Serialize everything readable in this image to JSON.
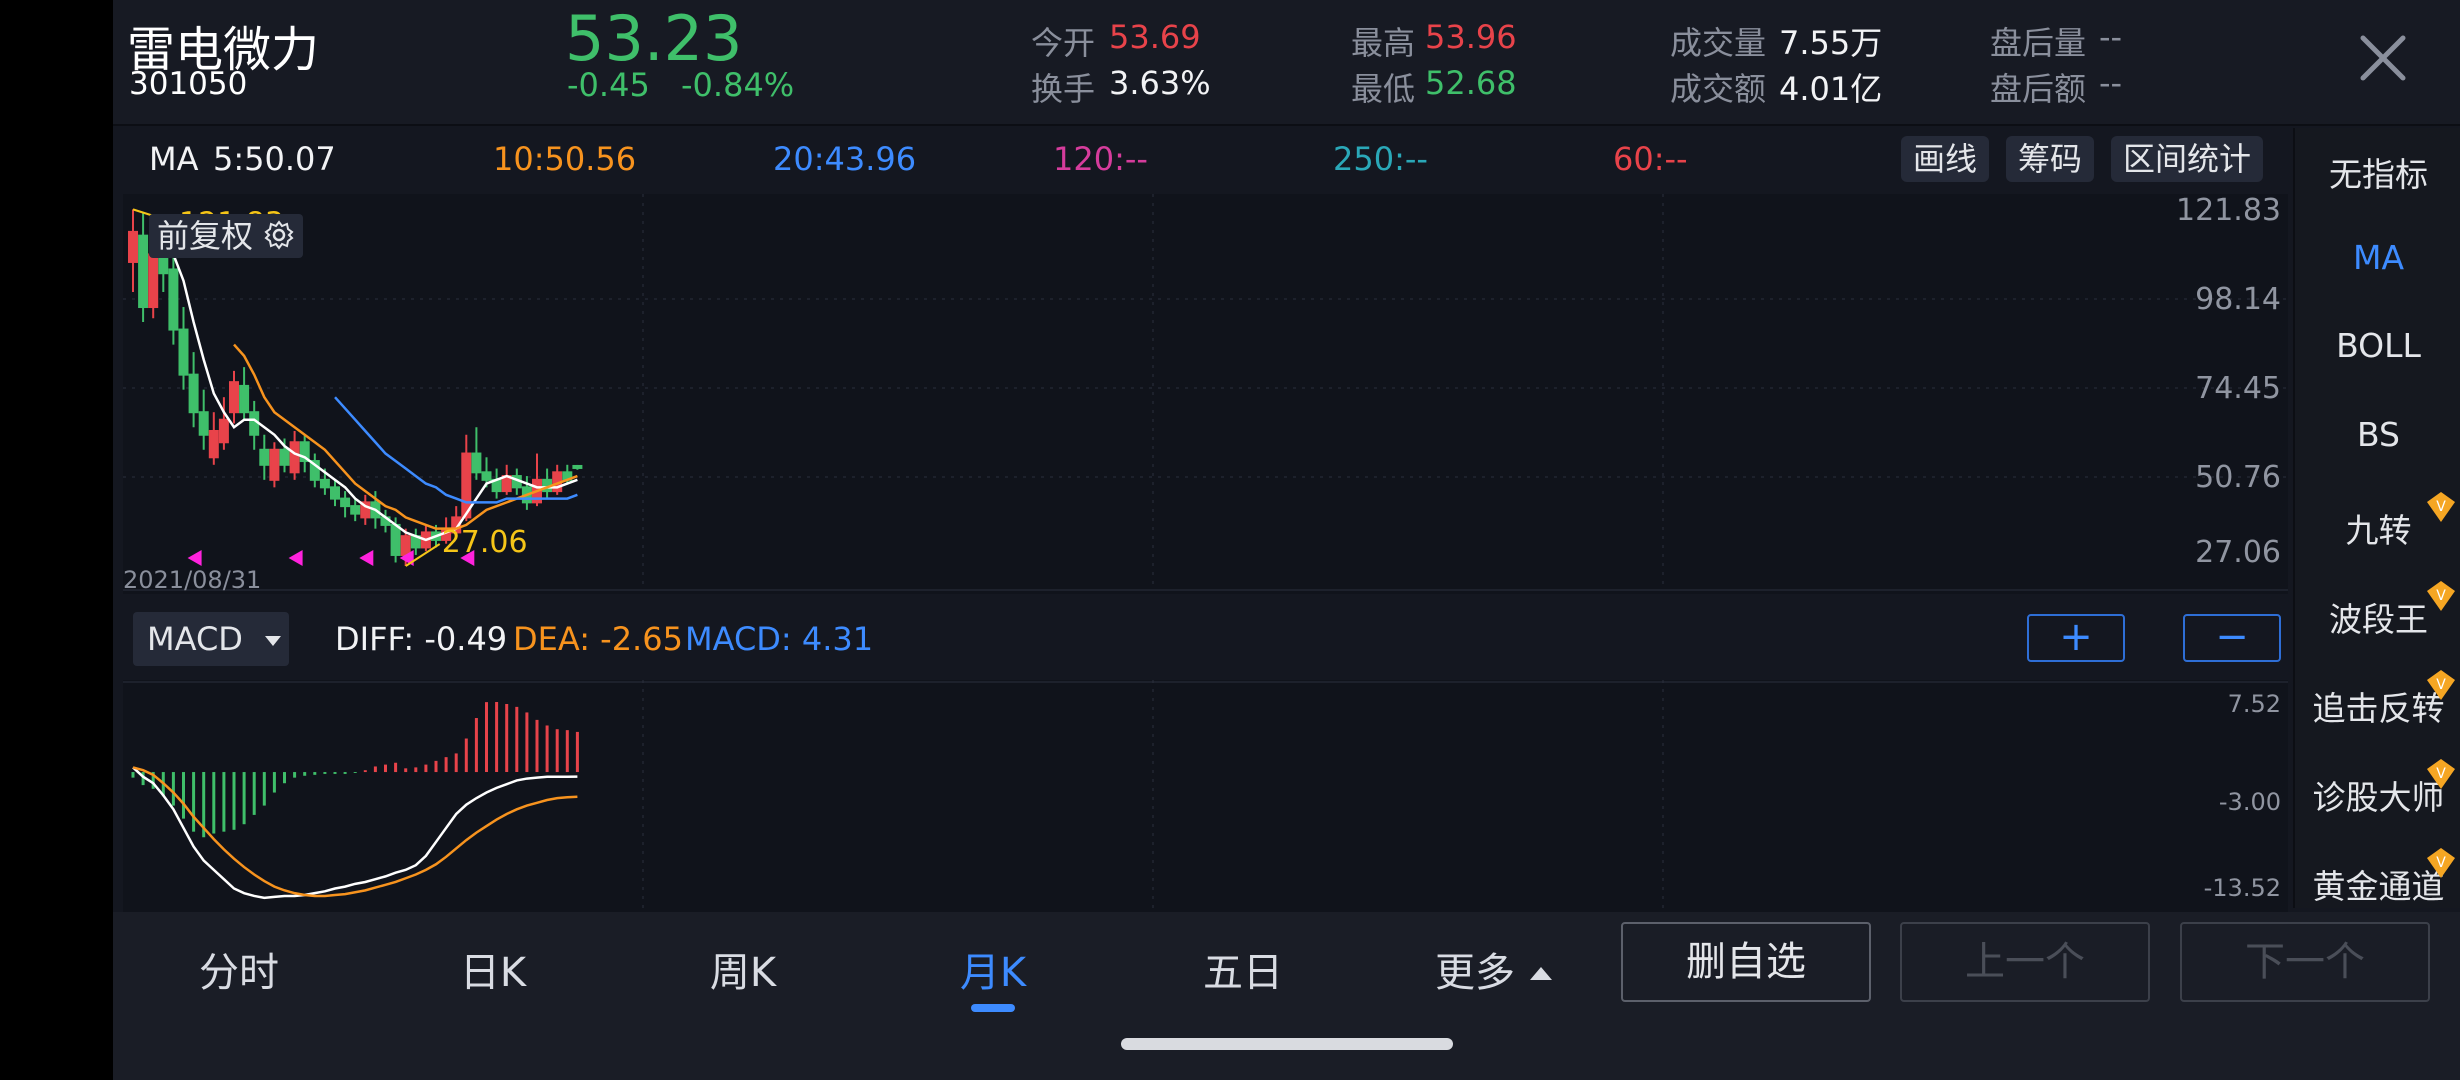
{
  "header": {
    "stock_name": "雷电微力",
    "stock_code": "301050",
    "price": "53.23",
    "change": "-0.45",
    "change_pct": "-0.84%",
    "stats": {
      "open_label": "今开",
      "open_value": "53.69",
      "high_label": "最高",
      "high_value": "53.96",
      "volume_label": "成交量",
      "volume_value": "7.55万",
      "after_vol_label": "盘后量",
      "after_vol_value": "--",
      "turnover_label": "换手",
      "turnover_value": "3.63%",
      "low_label": "最低",
      "low_value": "52.68",
      "amount_label": "成交额",
      "amount_value": "4.01亿",
      "after_amt_label": "盘后额",
      "after_amt_value": "--"
    }
  },
  "ma_bar": {
    "ma_label": "MA",
    "ma5": "5:50.07",
    "ma10": "10:50.56",
    "ma20": "20:43.96",
    "ma120": "120:--",
    "ma250": "250:--",
    "ma60": "60:--",
    "tool_draw": "画线",
    "tool_chips": "筹码",
    "tool_range": "区间统计"
  },
  "kline": {
    "adjust_label": "前复权",
    "date_label": "2021/08/31",
    "max_label": "121.83",
    "min_label": "27.06",
    "y_ticks": [
      "121.83",
      "98.14",
      "74.45",
      "50.76",
      "27.06"
    ]
  },
  "macd": {
    "selector": "MACD",
    "diff": "DIFF: -0.49",
    "dea": "DEA: -2.65",
    "macd": "MACD: 4.31",
    "plus": "+",
    "minus": "−",
    "y_ticks": [
      "7.52",
      "-3.00",
      "-13.52"
    ]
  },
  "sidebar": {
    "items": [
      "无指标",
      "MA",
      "BOLL",
      "BS",
      "九转",
      "波段王",
      "追击反转",
      "诊股大师",
      "黄金通道"
    ]
  },
  "bottom": {
    "tabs": [
      "分时",
      "日K",
      "周K",
      "月K",
      "五日",
      "更多"
    ],
    "btn_remove": "删自选",
    "btn_prev": "上一个",
    "btn_next": "下一个"
  },
  "colors": {
    "up": "#e8434a",
    "down": "#3fbf6a",
    "accent": "#3d8bff",
    "ma5": "#ffffff",
    "ma10": "#f7931e",
    "ma20": "#3d8bff"
  },
  "chart_data": {
    "type": "candlestick",
    "period": "monthly",
    "first_date": "2021/08/31",
    "ylim": [
      27.06,
      121.83
    ],
    "candles": [
      {
        "o": 108,
        "c": 116,
        "h": 122,
        "l": 100
      },
      {
        "o": 115,
        "c": 96,
        "h": 121,
        "l": 92
      },
      {
        "o": 96,
        "c": 110,
        "h": 114,
        "l": 93
      },
      {
        "o": 112,
        "c": 105,
        "h": 117,
        "l": 100
      },
      {
        "o": 106,
        "c": 90,
        "h": 110,
        "l": 86
      },
      {
        "o": 90,
        "c": 78,
        "h": 96,
        "l": 74
      },
      {
        "o": 78,
        "c": 68,
        "h": 84,
        "l": 64
      },
      {
        "o": 68,
        "c": 62,
        "h": 74,
        "l": 58
      },
      {
        "o": 56,
        "c": 63,
        "h": 68,
        "l": 54
      },
      {
        "o": 60,
        "c": 66,
        "h": 72,
        "l": 58
      },
      {
        "o": 68,
        "c": 76,
        "h": 79,
        "l": 65
      },
      {
        "o": 75,
        "c": 68,
        "h": 80,
        "l": 66
      },
      {
        "o": 68,
        "c": 62,
        "h": 71,
        "l": 58
      },
      {
        "o": 58,
        "c": 54,
        "h": 62,
        "l": 50
      },
      {
        "o": 50,
        "c": 58,
        "h": 60,
        "l": 48
      },
      {
        "o": 58,
        "c": 54,
        "h": 61,
        "l": 52
      },
      {
        "o": 52,
        "c": 60,
        "h": 63,
        "l": 50
      },
      {
        "o": 60,
        "c": 55,
        "h": 62,
        "l": 52
      },
      {
        "o": 55,
        "c": 50,
        "h": 57,
        "l": 48
      },
      {
        "o": 50,
        "c": 48,
        "h": 53,
        "l": 46
      },
      {
        "o": 48,
        "c": 45,
        "h": 50,
        "l": 43
      },
      {
        "o": 45,
        "c": 43,
        "h": 47,
        "l": 40
      },
      {
        "o": 43,
        "c": 41,
        "h": 45,
        "l": 39
      },
      {
        "o": 40,
        "c": 44,
        "h": 46,
        "l": 38
      },
      {
        "o": 44,
        "c": 40,
        "h": 47,
        "l": 37
      },
      {
        "o": 40,
        "c": 38,
        "h": 42,
        "l": 36
      },
      {
        "o": 38,
        "c": 30,
        "h": 40,
        "l": 28
      },
      {
        "o": 30,
        "c": 35,
        "h": 37,
        "l": 27.06
      },
      {
        "o": 35,
        "c": 32,
        "h": 37,
        "l": 30
      },
      {
        "o": 32,
        "c": 36,
        "h": 38,
        "l": 31
      },
      {
        "o": 36,
        "c": 34,
        "h": 38,
        "l": 32
      },
      {
        "o": 34,
        "c": 37,
        "h": 40,
        "l": 33
      },
      {
        "o": 36,
        "c": 40,
        "h": 43,
        "l": 35
      },
      {
        "o": 40,
        "c": 57,
        "h": 62,
        "l": 39
      },
      {
        "o": 57,
        "c": 52,
        "h": 64,
        "l": 50
      },
      {
        "o": 52,
        "c": 50,
        "h": 56,
        "l": 48
      },
      {
        "o": 50,
        "c": 47,
        "h": 53,
        "l": 45
      },
      {
        "o": 47,
        "c": 51,
        "h": 54,
        "l": 46
      },
      {
        "o": 51,
        "c": 48,
        "h": 53,
        "l": 46
      },
      {
        "o": 48,
        "c": 44,
        "h": 51,
        "l": 42
      },
      {
        "o": 44,
        "c": 50,
        "h": 57,
        "l": 43
      },
      {
        "o": 50,
        "c": 47,
        "h": 53,
        "l": 45
      },
      {
        "o": 47,
        "c": 52,
        "h": 54,
        "l": 46
      },
      {
        "o": 52,
        "c": 50,
        "h": 54,
        "l": 49
      },
      {
        "o": 53.69,
        "c": 53.23,
        "h": 53.96,
        "l": 52.68
      }
    ],
    "ma5": [
      null,
      null,
      null,
      null,
      110,
      103,
      92,
      82,
      73,
      68,
      64,
      66,
      66,
      64,
      62,
      59,
      57,
      56,
      54,
      52,
      50,
      48,
      45,
      43,
      42,
      40,
      38,
      36,
      35,
      34,
      35,
      36,
      37,
      41,
      45,
      49,
      50,
      51,
      50,
      49,
      48,
      48,
      48,
      49,
      50
    ],
    "ma10": [
      null,
      null,
      null,
      null,
      null,
      null,
      null,
      null,
      null,
      null,
      86,
      83,
      78,
      72,
      68,
      66,
      64,
      62,
      60,
      58,
      55,
      52,
      49,
      47,
      45,
      43,
      42,
      40,
      39,
      38,
      37,
      37,
      37,
      38,
      40,
      42,
      43,
      44,
      45,
      46,
      47,
      48,
      49,
      50,
      51
    ],
    "ma20": [
      null,
      null,
      null,
      null,
      null,
      null,
      null,
      null,
      null,
      null,
      null,
      null,
      null,
      null,
      null,
      null,
      null,
      null,
      null,
      null,
      72,
      69,
      66,
      63,
      60,
      57,
      55,
      53,
      51,
      49,
      48,
      46,
      45,
      44,
      44,
      44,
      44,
      45,
      45,
      45,
      45,
      45,
      45,
      45,
      46
    ],
    "markers": [
      6,
      16,
      23,
      27,
      33
    ],
    "macd": {
      "ylim": [
        -13.52,
        7.52
      ],
      "diff": [
        0.5,
        -0.5,
        -1.2,
        -2.5,
        -4.0,
        -6.0,
        -8.0,
        -9.5,
        -10.5,
        -11.5,
        -12.5,
        -13.0,
        -13.3,
        -13.5,
        -13.4,
        -13.3,
        -13.3,
        -13.2,
        -13.0,
        -12.8,
        -12.5,
        -12.3,
        -12.0,
        -11.8,
        -11.5,
        -11.2,
        -10.8,
        -10.5,
        -10.0,
        -9.0,
        -7.5,
        -6.0,
        -4.5,
        -3.5,
        -2.8,
        -2.2,
        -1.7,
        -1.3,
        -0.9,
        -0.7,
        -0.6,
        -0.5,
        -0.5,
        -0.5,
        -0.49
      ],
      "dea": [
        0.5,
        0.2,
        -0.3,
        -1.2,
        -2.2,
        -3.4,
        -4.8,
        -6.0,
        -7.2,
        -8.3,
        -9.3,
        -10.2,
        -11.0,
        -11.7,
        -12.3,
        -12.7,
        -13.0,
        -13.2,
        -13.3,
        -13.3,
        -13.2,
        -13.1,
        -12.9,
        -12.7,
        -12.4,
        -12.1,
        -11.8,
        -11.4,
        -11.0,
        -10.5,
        -9.9,
        -9.1,
        -8.2,
        -7.3,
        -6.5,
        -5.8,
        -5.1,
        -4.5,
        -4.0,
        -3.6,
        -3.3,
        -3.0,
        -2.8,
        -2.7,
        -2.65
      ],
      "hist": [
        -0.6,
        -1.4,
        -1.8,
        -2.6,
        -3.6,
        -5.0,
        -6.4,
        -7.0,
        -6.6,
        -6.4,
        -6.2,
        -5.6,
        -4.6,
        -3.6,
        -2.2,
        -1.2,
        -0.6,
        -0.4,
        -0.3,
        -0.2,
        -0.2,
        -0.2,
        -0.1,
        0.2,
        0.6,
        0.8,
        1.0,
        0.4,
        0.5,
        0.8,
        1.2,
        1.6,
        2.0,
        3.6,
        5.8,
        7.5,
        7.52,
        7.3,
        7.0,
        6.4,
        5.6,
        5.0,
        4.6,
        4.5,
        4.31
      ]
    }
  }
}
